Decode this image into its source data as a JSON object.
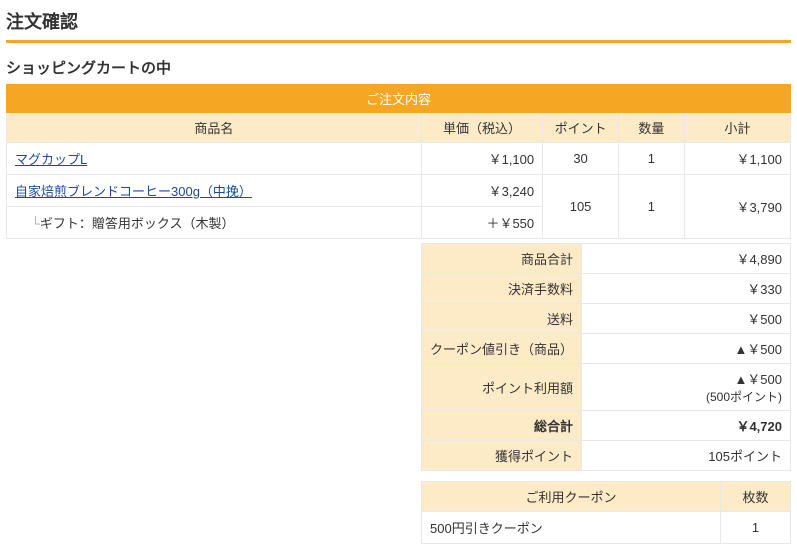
{
  "title": "注文確認",
  "subtitle": "ショッピングカートの中",
  "order": {
    "caption": "ご注文内容",
    "headers": {
      "name": "商品名",
      "unit_price": "単価（税込）",
      "point": "ポイント",
      "qty": "数量",
      "subtotal": "小計"
    },
    "items": [
      {
        "name": "マグカップL",
        "unit_price": "￥1,100",
        "point": "30",
        "qty": "1",
        "subtotal": "￥1,100",
        "addon": null
      },
      {
        "name": "自家焙煎ブレンドコーヒー300g（中挽）",
        "unit_price": "￥3,240",
        "point": "105",
        "qty": "1",
        "subtotal": "￥3,790",
        "addon": {
          "name": "ギフト：贈答用ボックス（木製）",
          "price": "＋￥550"
        }
      }
    ]
  },
  "summary": {
    "rows": [
      {
        "label": "商品合計",
        "value": "￥4,890"
      },
      {
        "label": "決済手数料",
        "value": "￥330"
      },
      {
        "label": "送料",
        "value": "￥500"
      },
      {
        "label": "クーポン値引き（商品）",
        "value": "▲￥500"
      },
      {
        "label": "ポイント利用額",
        "value": "▲￥500",
        "sub": "(500ポイント)"
      },
      {
        "label": "総合計",
        "value": "￥4,720",
        "total": true
      },
      {
        "label": "獲得ポイント",
        "value": "105ポイント"
      }
    ]
  },
  "coupons": {
    "headers": {
      "name": "ご利用クーポン",
      "count": "枚数"
    },
    "rows": [
      {
        "name": "500円引きクーポン",
        "count": "1"
      }
    ]
  }
}
